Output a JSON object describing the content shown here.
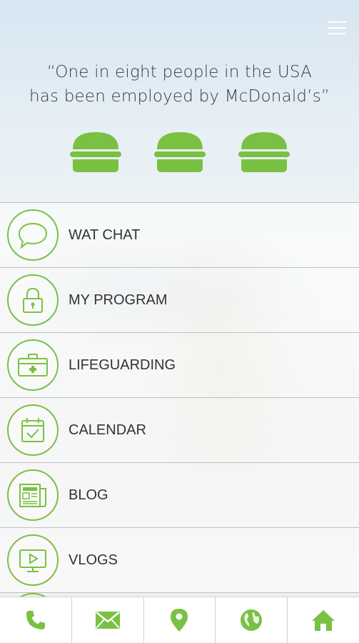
{
  "header": {
    "quote_line1": "“One in eight people in the USA",
    "quote_line2": "has been employed by McDonald’s”",
    "rating_icons": [
      "burger-icon",
      "burger-icon",
      "burger-icon"
    ]
  },
  "menu": {
    "items": [
      {
        "label": "WAT CHAT",
        "icon": "chat-bubble-icon"
      },
      {
        "label": "MY PROGRAM",
        "icon": "lock-icon"
      },
      {
        "label": "LIFEGUARDING",
        "icon": "first-aid-kit-icon"
      },
      {
        "label": "CALENDAR",
        "icon": "calendar-check-icon"
      },
      {
        "label": "BLOG",
        "icon": "newspaper-icon"
      },
      {
        "label": "VLOGS",
        "icon": "video-player-icon"
      }
    ]
  },
  "bottom_nav": [
    "phone-icon",
    "mail-icon",
    "location-pin-icon",
    "globe-icon",
    "home-icon"
  ],
  "colors": {
    "accent": "#7ac143",
    "text": "#333333",
    "divider": "#bfbfbf"
  }
}
